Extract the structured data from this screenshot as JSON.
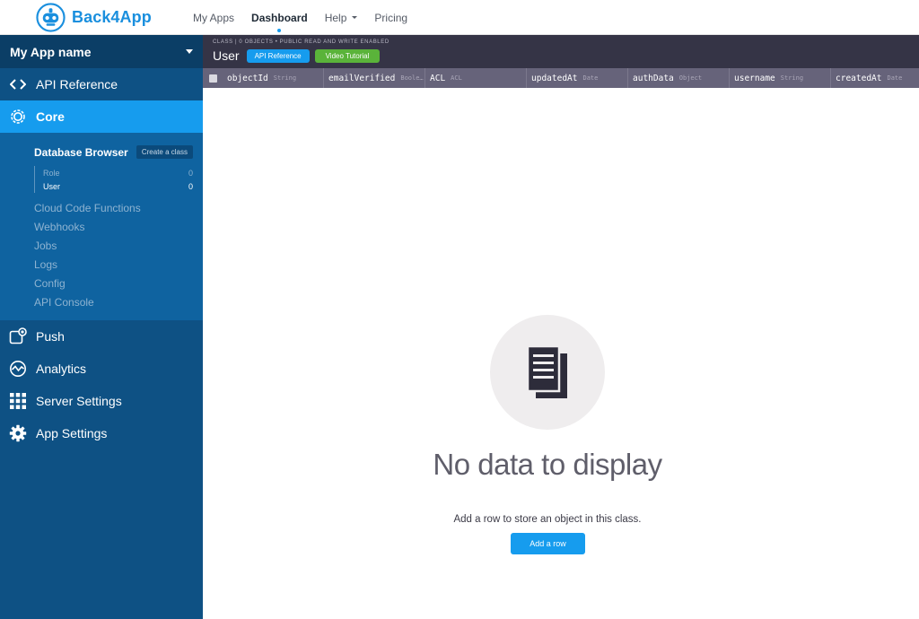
{
  "brand": {
    "name": "Back4App"
  },
  "nav": {
    "items": [
      "My Apps",
      "Dashboard",
      "Help",
      "Pricing"
    ]
  },
  "sidebar": {
    "app_name": "My App name",
    "api_reference": "API Reference",
    "core": "Core",
    "database_browser": "Database Browser",
    "create_class": "Create a class",
    "classes": [
      {
        "name": "Role",
        "count": "0"
      },
      {
        "name": "User",
        "count": "0"
      }
    ],
    "core_links": [
      "Cloud Code Functions",
      "Webhooks",
      "Jobs",
      "Logs",
      "Config",
      "API Console"
    ],
    "bottom_items": [
      "Push",
      "Analytics",
      "Server Settings",
      "App Settings"
    ]
  },
  "class_header": {
    "subtitle": "CLASS | 0 OBJECTS • PUBLIC READ AND WRITE ENABLED",
    "name": "User",
    "api_button": "API Reference",
    "video_button": "Video Tutorial"
  },
  "columns": [
    {
      "name": "objectId",
      "type": "String"
    },
    {
      "name": "emailVerified",
      "type": "Boole…"
    },
    {
      "name": "ACL",
      "type": "ACL"
    },
    {
      "name": "updatedAt",
      "type": "Date"
    },
    {
      "name": "authData",
      "type": "Object"
    },
    {
      "name": "username",
      "type": "String"
    },
    {
      "name": "createdAt",
      "type": "Date"
    }
  ],
  "empty_state": {
    "title": "No data to display",
    "message": "Add a row to store an object in this class.",
    "button": "Add a row"
  },
  "colors": {
    "brand_blue": "#169cee",
    "sidebar": "#0e5184",
    "header_dark": "#353446",
    "video_green": "#5ab33a"
  }
}
